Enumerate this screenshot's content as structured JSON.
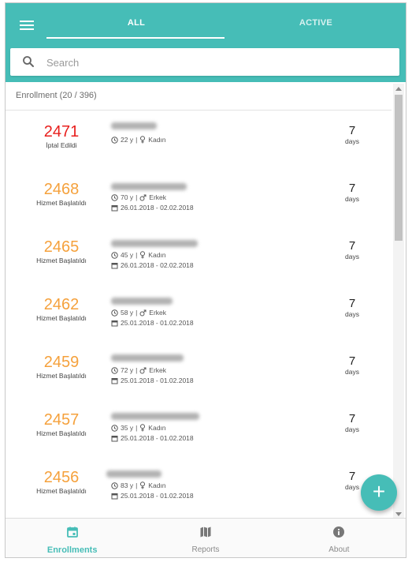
{
  "colors": {
    "accent": "#46bdb7",
    "cancelled": "#e8201e",
    "in_progress": "#f5a13c"
  },
  "tabs": [
    {
      "label": "ALL"
    },
    {
      "label": "ACTIVE"
    }
  ],
  "search": {
    "placeholder": "Search"
  },
  "list_header": "Enrollment (20 / 396)",
  "rows": [
    {
      "number": "2471",
      "status": "İptal Edildi",
      "status_type": "cancelled",
      "age": "22 y",
      "gender": "Kadın",
      "gender_icon": "female-icon",
      "date_range": "",
      "days": "7",
      "days_label": "days"
    },
    {
      "number": "2468",
      "status": "Hizmet Başlatıldı",
      "status_type": "in_progress",
      "age": "70 y",
      "gender": "Erkek",
      "gender_icon": "male-icon",
      "date_range": "26.01.2018 - 02.02.2018",
      "days": "7",
      "days_label": "days"
    },
    {
      "number": "2465",
      "status": "Hizmet Başlatıldı",
      "status_type": "in_progress",
      "age": "45 y",
      "gender": "Kadın",
      "gender_icon": "female-icon",
      "date_range": "26.01.2018 - 02.02.2018",
      "days": "7",
      "days_label": "days"
    },
    {
      "number": "2462",
      "status": "Hizmet Başlatıldı",
      "status_type": "in_progress",
      "age": "58 y",
      "gender": "Erkek",
      "gender_icon": "male-icon",
      "date_range": "25.01.2018 - 01.02.2018",
      "days": "7",
      "days_label": "days"
    },
    {
      "number": "2459",
      "status": "Hizmet Başlatıldı",
      "status_type": "in_progress",
      "age": "72 y",
      "gender": "Erkek",
      "gender_icon": "male-icon",
      "date_range": "25.01.2018 - 01.02.2018",
      "days": "7",
      "days_label": "days"
    },
    {
      "number": "2457",
      "status": "Hizmet Başlatıldı",
      "status_type": "in_progress",
      "age": "35 y",
      "gender": "Kadın",
      "gender_icon": "female-icon",
      "date_range": "25.01.2018 - 01.02.2018",
      "days": "7",
      "days_label": "days"
    },
    {
      "number": "2456",
      "status": "Hizmet Başlatıldı",
      "status_type": "in_progress",
      "age": "83 y",
      "gender": "Kadın",
      "gender_icon": "female-icon",
      "date_range": "25.01.2018 - 01.02.2018",
      "days": "7",
      "days_label": "days"
    }
  ],
  "fab": {
    "label": "+"
  },
  "bottom_nav": [
    {
      "label": "Enrollments",
      "icon": "calendar-icon",
      "active": true
    },
    {
      "label": "Reports",
      "icon": "map-icon",
      "active": false
    },
    {
      "label": "About",
      "icon": "info-icon",
      "active": false
    }
  ]
}
